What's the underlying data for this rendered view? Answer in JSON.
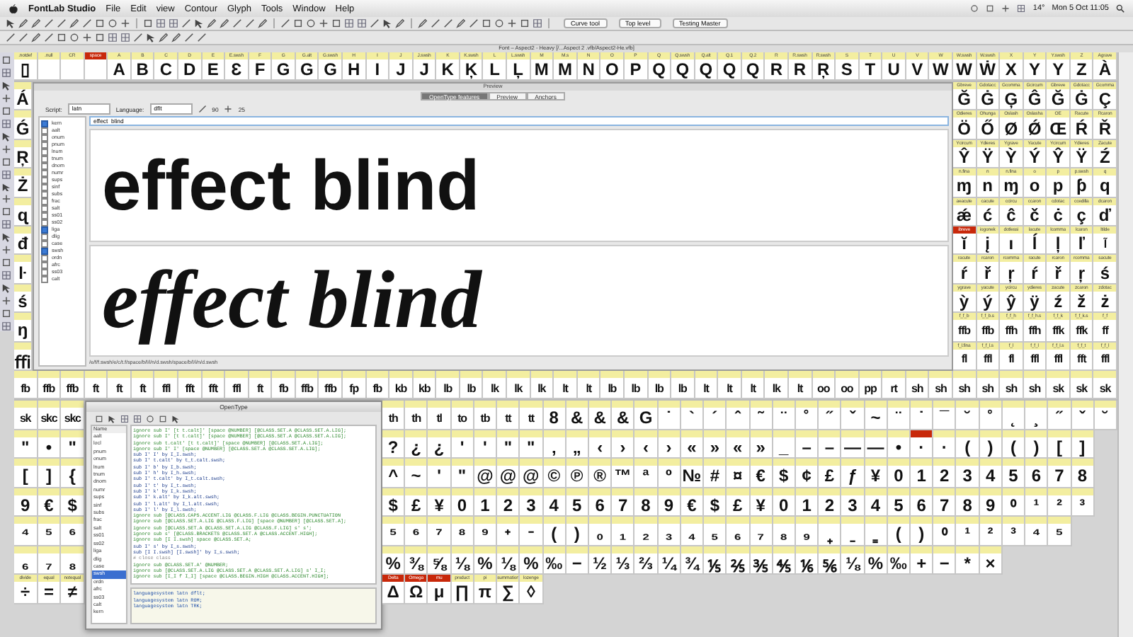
{
  "menubar": {
    "app": "FontLab Studio",
    "items": [
      "File",
      "Edit",
      "view",
      "Contour",
      "Glyph",
      "Tools",
      "Window",
      "Help"
    ],
    "temperature": "14°",
    "clock": "Mon 5 Oct  11:05"
  },
  "toolbar": {
    "dropdowns": [
      "Curve tool",
      "Top level",
      "Testing Master"
    ]
  },
  "font_window": {
    "title": "Font – Aspect2 - Heavy [/...Aspect 2 .vfb/Aspect2-He.vfb]",
    "top_row": [
      {
        "label": ".notdef",
        "glyph": "▯",
        "marked": false
      },
      {
        "label": ".null",
        "marked": false
      },
      {
        "label": "CR",
        "marked": false
      },
      {
        "label": "space",
        "marked": true
      },
      {
        "label": "A",
        "glyph": "A",
        "marked": false
      },
      {
        "label": "B",
        "glyph": "B",
        "marked": false
      },
      {
        "label": "C",
        "glyph": "C",
        "marked": false
      },
      {
        "label": "D",
        "glyph": "D",
        "marked": false
      },
      {
        "label": "E",
        "glyph": "E",
        "marked": false
      },
      {
        "label": "E.swsh",
        "glyph": "Ɛ",
        "marked": false
      },
      {
        "label": "F",
        "glyph": "F",
        "marked": false
      },
      {
        "label": "G",
        "glyph": "G",
        "marked": false
      },
      {
        "label": "G.alt",
        "glyph": "G",
        "marked": false
      },
      {
        "label": "G.swsh",
        "glyph": "G",
        "marked": false
      },
      {
        "label": "H",
        "glyph": "H",
        "marked": false
      },
      {
        "label": "I",
        "glyph": "I",
        "marked": false
      },
      {
        "label": "J",
        "glyph": "J",
        "marked": false
      },
      {
        "label": "J.swsh",
        "glyph": "J",
        "marked": false
      },
      {
        "label": "K",
        "glyph": "K",
        "marked": false
      },
      {
        "label": "K.swsh",
        "glyph": "Ķ",
        "marked": false
      },
      {
        "label": "L",
        "glyph": "L",
        "marked": false
      },
      {
        "label": "L.swsh",
        "glyph": "Ļ",
        "marked": false
      },
      {
        "label": "M",
        "glyph": "M",
        "marked": false
      },
      {
        "label": "M.s",
        "glyph": "M",
        "marked": false
      },
      {
        "label": "N",
        "glyph": "N",
        "marked": false
      },
      {
        "label": "O",
        "glyph": "O",
        "marked": false
      },
      {
        "label": "P",
        "glyph": "P",
        "marked": false
      },
      {
        "label": "Q",
        "glyph": "Q",
        "marked": false
      },
      {
        "label": "Q.swsh",
        "glyph": "Q",
        "marked": false
      },
      {
        "label": "Q.alt",
        "glyph": "Q",
        "marked": false
      },
      {
        "label": "Q.1",
        "glyph": "Q",
        "marked": false
      },
      {
        "label": "Q.2",
        "glyph": "Q",
        "marked": false
      },
      {
        "label": "R",
        "glyph": "R",
        "marked": false
      },
      {
        "label": "R.swsh",
        "glyph": "R",
        "marked": false
      },
      {
        "label": "R.swsh",
        "glyph": "Ŗ",
        "marked": false
      },
      {
        "label": "S",
        "glyph": "S",
        "marked": false
      },
      {
        "label": "T",
        "glyph": "T",
        "marked": false
      },
      {
        "label": "U",
        "glyph": "U",
        "marked": false
      },
      {
        "label": "V",
        "glyph": "V",
        "marked": false
      },
      {
        "label": "W",
        "glyph": "W",
        "marked": false
      },
      {
        "label": "W.swsh",
        "glyph": "W",
        "marked": false
      },
      {
        "label": "W.swsh",
        "glyph": "Ẇ",
        "marked": false
      },
      {
        "label": "X",
        "glyph": "X",
        "marked": false
      },
      {
        "label": "Y",
        "glyph": "Y",
        "marked": false
      },
      {
        "label": "Y.swsh",
        "glyph": "Y",
        "marked": false
      },
      {
        "label": "Z",
        "glyph": "Z",
        "marked": false
      },
      {
        "label": "Agrave",
        "glyph": "À",
        "marked": false
      }
    ],
    "left_column": [
      {
        "glyph": "Á",
        "marked": false
      },
      {
        "glyph": "Ǵ",
        "marked": false
      },
      {
        "glyph": "Ŗ",
        "marked": false
      },
      {
        "glyph": "Ż",
        "marked": false
      },
      {
        "glyph": "ɋ",
        "marked": false
      },
      {
        "glyph": "đ",
        "marked": false
      },
      {
        "glyph": "ŀ",
        "marked": false
      },
      {
        "glyph": "ś",
        "marked": false
      },
      {
        "glyph": "ŋ",
        "marked": false
      },
      {
        "glyph": "ﬃ",
        "marked": false
      }
    ],
    "right_columns": [
      {
        "cells": [
          {
            "label": "Gbreve",
            "glyph": "Ğ",
            "marked": false
          },
          {
            "label": "Gdotacc",
            "glyph": "Ġ",
            "marked": false
          },
          {
            "label": "Gcomma",
            "glyph": "Ģ",
            "marked": false
          },
          {
            "label": "Gcircum",
            "glyph": "Ĝ",
            "marked": false
          },
          {
            "label": "Gbreve",
            "glyph": "Ğ",
            "marked": false
          },
          {
            "label": "Gdotacc",
            "glyph": "Ġ",
            "marked": false
          },
          {
            "label": "Gcomma",
            "glyph": "Ç",
            "marked": false
          }
        ]
      },
      {
        "cells": [
          {
            "label": "Odieres",
            "glyph": "Ö",
            "marked": false
          },
          {
            "label": "Ohunga",
            "glyph": "Ő",
            "marked": false
          },
          {
            "label": "Oslash",
            "glyph": "Ø",
            "marked": false
          },
          {
            "label": "Oslasha",
            "glyph": "Ǿ",
            "marked": false
          },
          {
            "label": "OE",
            "glyph": "Œ",
            "marked": false
          },
          {
            "label": "Racute",
            "glyph": "Ŕ",
            "marked": false
          },
          {
            "label": "Rcaron",
            "glyph": "Ř",
            "marked": false
          }
        ]
      },
      {
        "cells": [
          {
            "label": "Ycircum",
            "glyph": "Ŷ",
            "marked": false
          },
          {
            "label": "Ydieres",
            "glyph": "Ÿ",
            "marked": false
          },
          {
            "label": "Ygrave",
            "glyph": "Ỳ",
            "marked": false
          },
          {
            "label": "Yacute",
            "glyph": "Ý",
            "marked": false
          },
          {
            "label": "Ycircum",
            "glyph": "Ŷ",
            "marked": false
          },
          {
            "label": "Ydieres",
            "glyph": "Ÿ",
            "marked": false
          },
          {
            "label": "Zacute",
            "glyph": "Ź",
            "marked": false
          }
        ]
      },
      {
        "cells": [
          {
            "label": "n.fina",
            "glyph": "ɱ",
            "marked": false
          },
          {
            "label": "n",
            "glyph": "n",
            "marked": false
          },
          {
            "label": "n.fina",
            "glyph": "ɱ",
            "marked": false
          },
          {
            "label": "o",
            "glyph": "o",
            "marked": false
          },
          {
            "label": "p",
            "glyph": "p",
            "marked": false
          },
          {
            "label": "p.swsh",
            "glyph": "ƥ",
            "marked": false
          },
          {
            "label": "q",
            "glyph": "q",
            "marked": false
          }
        ]
      },
      {
        "cells": [
          {
            "label": "aeacute",
            "glyph": "ǽ",
            "marked": false
          },
          {
            "label": "cacute",
            "glyph": "ć",
            "marked": false
          },
          {
            "label": "ccircu",
            "glyph": "ĉ",
            "marked": false
          },
          {
            "label": "ccaron",
            "glyph": "č",
            "marked": false
          },
          {
            "label": "cdotac",
            "glyph": "ċ",
            "marked": false
          },
          {
            "label": "ccedilla",
            "glyph": "ç",
            "marked": false
          },
          {
            "label": "dcaron",
            "glyph": "ď",
            "marked": false
          }
        ]
      },
      {
        "cells": [
          {
            "label": "ibreve",
            "glyph": "ĭ",
            "marked": true
          },
          {
            "label": "iogonek",
            "glyph": "į",
            "marked": false
          },
          {
            "label": "dotlessi",
            "glyph": "ı",
            "marked": false
          },
          {
            "label": "lacute",
            "glyph": "ĺ",
            "marked": false
          },
          {
            "label": "lcomma",
            "glyph": "ļ",
            "marked": false
          },
          {
            "label": "lcaron",
            "glyph": "ľ",
            "marked": false
          },
          {
            "label": "ltilde",
            "glyph": "l̃",
            "marked": false
          }
        ]
      },
      {
        "cells": [
          {
            "label": "racute",
            "glyph": "ŕ",
            "marked": false
          },
          {
            "label": "rcaron",
            "glyph": "ř",
            "marked": false
          },
          {
            "label": "rcomma",
            "glyph": "ŗ",
            "marked": false
          },
          {
            "label": "racute",
            "glyph": "ŕ",
            "marked": false
          },
          {
            "label": "rcaron",
            "glyph": "ř",
            "marked": false
          },
          {
            "label": "rcomma",
            "glyph": "ŗ",
            "marked": false
          },
          {
            "label": "sacute",
            "glyph": "ś",
            "marked": false
          }
        ]
      },
      {
        "cells": [
          {
            "label": "ygrave",
            "glyph": "ỳ",
            "marked": false
          },
          {
            "label": "yacute",
            "glyph": "ý",
            "marked": false
          },
          {
            "label": "ycircu",
            "glyph": "ŷ",
            "marked": false
          },
          {
            "label": "ydieres",
            "glyph": "ÿ",
            "marked": false
          },
          {
            "label": "zacute",
            "glyph": "ź",
            "marked": false
          },
          {
            "label": "zcaron",
            "glyph": "ž",
            "marked": false
          },
          {
            "label": "zdotac",
            "glyph": "ż",
            "marked": false
          }
        ]
      },
      {
        "cells": [
          {
            "label": "f_f_b",
            "glyph": "ffb",
            "marked": false
          },
          {
            "label": "f_f_b.s",
            "glyph": "ffb",
            "marked": false
          },
          {
            "label": "f_f_h",
            "glyph": "ffh",
            "marked": false
          },
          {
            "label": "f_f_h.s",
            "glyph": "ffh",
            "marked": false
          },
          {
            "label": "f_f_k",
            "glyph": "ffk",
            "marked": false
          },
          {
            "label": "f_f_k.s",
            "glyph": "ffk",
            "marked": false
          },
          {
            "label": "f_f",
            "glyph": "ff",
            "marked": false
          }
        ]
      },
      {
        "cells": [
          {
            "label": "f_l.fina",
            "glyph": "fl",
            "marked": false
          },
          {
            "label": "f_f_l.s",
            "glyph": "ffl",
            "marked": false
          },
          {
            "label": "f_l",
            "glyph": "fl",
            "marked": false
          },
          {
            "label": "f_f_l",
            "glyph": "ffl",
            "marked": false
          },
          {
            "label": "f_f_l.s",
            "glyph": "ffl",
            "marked": false
          },
          {
            "label": "f_f_t",
            "glyph": "fft",
            "marked": false
          },
          {
            "label": "f_f_l",
            "glyph": "ffl",
            "marked": false
          }
        ]
      }
    ],
    "ligature_row": [
      "fb",
      "ffb",
      "ffb",
      "ft",
      "ft",
      "ft",
      "ffl",
      "fft",
      "fft",
      "ffl",
      "ft",
      "fb",
      "ffb",
      "ffb",
      "fp",
      "fb",
      "kb",
      "kb",
      "lb",
      "lb",
      "lk",
      "lk",
      "lk",
      "lt",
      "lt",
      "lb",
      "lb",
      "lb",
      "lb",
      "lt",
      "lt",
      "lt",
      "lk",
      "lt",
      "oo",
      "oo",
      "pp",
      "rt",
      "sh",
      "sh",
      "sh",
      "sh",
      "sh",
      "sh",
      "sk",
      "sk",
      "sk"
    ],
    "lower_left": [
      {
        "cells": [
          {
            "glyph": "sk",
            "marked": false
          },
          {
            "glyph": "skc",
            "marked": false
          },
          {
            "glyph": "skc",
            "marked": false
          }
        ]
      },
      {
        "cells": [
          {
            "glyph": "\"",
            "marked": false
          },
          {
            "glyph": "•",
            "marked": false
          },
          {
            "glyph": "\"",
            "marked": false
          }
        ]
      },
      {
        "cells": [
          {
            "glyph": "[",
            "marked": false
          },
          {
            "glyph": "]",
            "marked": false
          },
          {
            "glyph": "{",
            "marked": false
          }
        ]
      },
      {
        "cells": [
          {
            "glyph": "9",
            "marked": false
          },
          {
            "glyph": "€",
            "marked": false
          },
          {
            "glyph": "$",
            "marked": false
          }
        ]
      },
      {
        "cells": [
          {
            "glyph": "⁴",
            "marked": false
          },
          {
            "glyph": "⁵",
            "marked": false
          },
          {
            "glyph": "⁶",
            "marked": false
          }
        ]
      },
      {
        "cells": [
          {
            "glyph": "₆",
            "marked": false
          },
          {
            "glyph": "₇",
            "marked": false
          },
          {
            "glyph": "₈",
            "marked": false
          }
        ]
      },
      {
        "cells": [
          {
            "label": "divide",
            "glyph": "÷",
            "marked": false
          },
          {
            "label": "equal",
            "glyph": "=",
            "marked": false
          },
          {
            "label": "notequal",
            "glyph": "≠",
            "marked": false
          }
        ]
      }
    ],
    "lower_right": [
      {
        "cells": [
          {
            "glyph": "th",
            "marked": false
          },
          {
            "glyph": "th",
            "marked": false
          },
          {
            "glyph": "tl",
            "marked": false
          },
          {
            "glyph": "to",
            "marked": false
          },
          {
            "glyph": "tb",
            "marked": false
          },
          {
            "glyph": "tt",
            "marked": false
          },
          {
            "glyph": "tt",
            "marked": false
          },
          {
            "glyph": "8",
            "marked": false
          },
          {
            "glyph": "&",
            "marked": false
          },
          {
            "glyph": "&",
            "marked": false
          },
          {
            "glyph": "&",
            "marked": false
          },
          {
            "glyph": "G",
            "marked": false
          },
          {
            "glyph": "˙",
            "marked": false
          },
          {
            "glyph": "`",
            "marked": false
          },
          {
            "glyph": "´",
            "marked": false
          },
          {
            "glyph": "ˆ",
            "marked": false
          },
          {
            "glyph": "˜",
            "marked": false
          },
          {
            "glyph": "¨",
            "marked": false
          },
          {
            "glyph": "˚",
            "marked": false
          },
          {
            "glyph": "˝",
            "marked": false
          },
          {
            "glyph": "ˇ",
            "marked": false
          },
          {
            "glyph": "~",
            "marked": false
          },
          {
            "glyph": "¨",
            "marked": false
          },
          {
            "glyph": "˙",
            "marked": false
          },
          {
            "glyph": "¯",
            "marked": false
          },
          {
            "glyph": "˘",
            "marked": false
          },
          {
            "glyph": "˚",
            "marked": false
          },
          {
            "glyph": "˛",
            "marked": false
          },
          {
            "glyph": "¸",
            "marked": false
          },
          {
            "glyph": "˝",
            "marked": false
          },
          {
            "glyph": "ˇ",
            "marked": false
          },
          {
            "glyph": "˘",
            "marked": false
          }
        ]
      },
      {
        "cells": [
          {
            "glyph": "?",
            "marked": false
          },
          {
            "glyph": "¿",
            "marked": false
          },
          {
            "glyph": "¿",
            "marked": false
          },
          {
            "glyph": "'",
            "marked": false
          },
          {
            "glyph": "'",
            "marked": false
          },
          {
            "glyph": "\"",
            "marked": false
          },
          {
            "glyph": "\"",
            "marked": false
          },
          {
            "glyph": "‚",
            "marked": false
          },
          {
            "glyph": "„",
            "marked": false
          },
          {
            "glyph": "‹",
            "marked": false
          },
          {
            "glyph": "›",
            "marked": false
          },
          {
            "glyph": "‹",
            "marked": false
          },
          {
            "glyph": "›",
            "marked": false
          },
          {
            "glyph": "«",
            "marked": false
          },
          {
            "glyph": "»",
            "marked": false
          },
          {
            "glyph": "«",
            "marked": false
          },
          {
            "glyph": "»",
            "marked": false
          },
          {
            "glyph": "_",
            "marked": false
          },
          {
            "glyph": "–",
            "marked": false
          },
          {
            "glyph": "–",
            "marked": false
          },
          {
            "glyph": "—",
            "marked": false
          },
          {
            "glyph": "—",
            "marked": false
          },
          {
            "glyph": "•",
            "marked": false
          },
          {
            "glyph": "·",
            "marked": true
          },
          {
            "glyph": "·",
            "marked": false
          },
          {
            "glyph": "(",
            "marked": false
          },
          {
            "glyph": ")",
            "marked": false
          },
          {
            "glyph": "(",
            "marked": false
          },
          {
            "glyph": ")",
            "marked": false
          },
          {
            "glyph": "[",
            "marked": false
          },
          {
            "glyph": "]",
            "marked": false
          }
        ]
      },
      {
        "cells": [
          {
            "glyph": "^",
            "marked": false
          },
          {
            "glyph": "~",
            "marked": false
          },
          {
            "glyph": "'",
            "marked": false
          },
          {
            "glyph": "\"",
            "marked": false
          },
          {
            "glyph": "@",
            "marked": false
          },
          {
            "glyph": "@",
            "marked": false
          },
          {
            "glyph": "@",
            "marked": false
          },
          {
            "glyph": "©",
            "marked": false
          },
          {
            "glyph": "℗",
            "marked": false
          },
          {
            "glyph": "®",
            "marked": false
          },
          {
            "glyph": "™",
            "marked": false
          },
          {
            "glyph": "ª",
            "marked": false
          },
          {
            "glyph": "º",
            "marked": false
          },
          {
            "glyph": "№",
            "marked": false
          },
          {
            "glyph": "#",
            "marked": false
          },
          {
            "glyph": "¤",
            "marked": false
          },
          {
            "glyph": "€",
            "marked": false
          },
          {
            "glyph": "$",
            "marked": false
          },
          {
            "glyph": "¢",
            "marked": false
          },
          {
            "glyph": "£",
            "marked": false
          },
          {
            "glyph": "ƒ",
            "marked": false
          },
          {
            "glyph": "¥",
            "marked": false
          },
          {
            "glyph": "0",
            "marked": false
          },
          {
            "glyph": "1",
            "marked": false
          },
          {
            "glyph": "2",
            "marked": false
          },
          {
            "glyph": "3",
            "marked": false
          },
          {
            "glyph": "4",
            "marked": false
          },
          {
            "glyph": "5",
            "marked": false
          },
          {
            "glyph": "6",
            "marked": false
          },
          {
            "glyph": "7",
            "marked": false
          },
          {
            "glyph": "8",
            "marked": false
          }
        ]
      },
      {
        "cells": [
          {
            "glyph": "$",
            "marked": false
          },
          {
            "glyph": "£",
            "marked": false
          },
          {
            "glyph": "¥",
            "marked": false
          },
          {
            "glyph": "0",
            "marked": false
          },
          {
            "glyph": "1",
            "marked": false
          },
          {
            "glyph": "2",
            "marked": false
          },
          {
            "glyph": "3",
            "marked": false
          },
          {
            "glyph": "4",
            "marked": false
          },
          {
            "glyph": "5",
            "marked": false
          },
          {
            "glyph": "6",
            "marked": false
          },
          {
            "glyph": "7",
            "marked": false
          },
          {
            "glyph": "8",
            "marked": false
          },
          {
            "glyph": "9",
            "marked": false
          },
          {
            "glyph": "€",
            "marked": false
          },
          {
            "glyph": "$",
            "marked": false
          },
          {
            "glyph": "£",
            "marked": false
          },
          {
            "glyph": "¥",
            "marked": false
          },
          {
            "glyph": "0",
            "marked": false
          },
          {
            "glyph": "1",
            "marked": false
          },
          {
            "glyph": "2",
            "marked": false
          },
          {
            "glyph": "3",
            "marked": false
          },
          {
            "glyph": "4",
            "marked": false
          },
          {
            "glyph": "5",
            "marked": false
          },
          {
            "glyph": "6",
            "marked": false
          },
          {
            "glyph": "7",
            "marked": false
          },
          {
            "glyph": "8",
            "marked": false
          },
          {
            "glyph": "9",
            "marked": false
          },
          {
            "glyph": "⁰",
            "marked": false
          },
          {
            "glyph": "¹",
            "marked": false
          },
          {
            "glyph": "²",
            "marked": false
          },
          {
            "glyph": "³",
            "marked": false
          }
        ]
      },
      {
        "cells": [
          {
            "glyph": "⁵",
            "marked": false
          },
          {
            "glyph": "⁶",
            "marked": false
          },
          {
            "glyph": "⁷",
            "marked": false
          },
          {
            "glyph": "⁸",
            "marked": false
          },
          {
            "glyph": "⁹",
            "marked": false
          },
          {
            "glyph": "⁺",
            "marked": false
          },
          {
            "glyph": "⁻",
            "marked": false
          },
          {
            "glyph": "(",
            "marked": false
          },
          {
            "glyph": ")",
            "marked": false
          },
          {
            "glyph": "₀",
            "marked": false
          },
          {
            "glyph": "₁",
            "marked": false
          },
          {
            "glyph": "₂",
            "marked": false
          },
          {
            "glyph": "₃",
            "marked": false
          },
          {
            "glyph": "₄",
            "marked": false
          },
          {
            "glyph": "₅",
            "marked": false
          },
          {
            "glyph": "₆",
            "marked": false
          },
          {
            "glyph": "₇",
            "marked": false
          },
          {
            "glyph": "₈",
            "marked": false
          },
          {
            "glyph": "₉",
            "marked": false
          },
          {
            "glyph": "₊",
            "marked": false
          },
          {
            "glyph": "₋",
            "marked": false
          },
          {
            "glyph": "₌",
            "marked": false
          },
          {
            "glyph": "(",
            "marked": false
          },
          {
            "glyph": ")",
            "marked": false
          },
          {
            "glyph": "⁰",
            "marked": false
          },
          {
            "glyph": "¹",
            "marked": false
          },
          {
            "glyph": "²",
            "marked": false
          },
          {
            "glyph": "³",
            "marked": false
          },
          {
            "glyph": "⁴",
            "marked": false
          },
          {
            "glyph": "⁵",
            "marked": false
          }
        ]
      },
      {
        "cells": [
          {
            "glyph": "%",
            "marked": false
          },
          {
            "glyph": "⅜",
            "marked": false
          },
          {
            "glyph": "⅝",
            "marked": false
          },
          {
            "glyph": "⅛",
            "marked": false
          },
          {
            "glyph": "%",
            "marked": false
          },
          {
            "glyph": "⅛",
            "marked": false
          },
          {
            "glyph": "%",
            "marked": false
          },
          {
            "glyph": "‰",
            "marked": false
          },
          {
            "glyph": "−",
            "marked": false
          },
          {
            "glyph": "½",
            "marked": false
          },
          {
            "glyph": "⅓",
            "marked": false
          },
          {
            "glyph": "⅔",
            "marked": false
          },
          {
            "glyph": "¼",
            "marked": false
          },
          {
            "glyph": "¾",
            "marked": false
          },
          {
            "glyph": "⅕",
            "marked": false
          },
          {
            "glyph": "⅖",
            "marked": false
          },
          {
            "glyph": "⅗",
            "marked": false
          },
          {
            "glyph": "⅘",
            "marked": false
          },
          {
            "glyph": "⅙",
            "marked": false
          },
          {
            "glyph": "⅚",
            "marked": false
          },
          {
            "glyph": "⅛",
            "marked": false
          },
          {
            "glyph": "%",
            "marked": false
          },
          {
            "glyph": "‰",
            "marked": false
          },
          {
            "glyph": "+",
            "marked": false
          },
          {
            "glyph": "−",
            "marked": false
          },
          {
            "glyph": "*",
            "marked": false
          },
          {
            "glyph": "×",
            "marked": false
          }
        ]
      },
      {
        "cells": [
          {
            "label": "Delta",
            "glyph": "Δ",
            "marked": true
          },
          {
            "label": "Omega",
            "glyph": "Ω",
            "marked": true
          },
          {
            "label": "mu",
            "glyph": "μ",
            "marked": true
          },
          {
            "label": "product",
            "glyph": "∏",
            "marked": false
          },
          {
            "label": "pi",
            "glyph": "π",
            "marked": false
          },
          {
            "label": "summation",
            "glyph": "∑",
            "marked": false
          },
          {
            "label": "lozenge",
            "glyph": "◊",
            "marked": false
          }
        ]
      }
    ]
  },
  "preview": {
    "title": "Preview",
    "tabs": [
      {
        "label": "OpenType features",
        "selected": true
      },
      {
        "label": "Preview",
        "selected": false
      },
      {
        "label": "Anchors",
        "selected": false
      }
    ],
    "script_label": "Script:",
    "script": "latn",
    "language_label": "Language:",
    "language": "dflt",
    "line_size": "90",
    "spacing": "25",
    "features": [
      {
        "label": "kern",
        "checked": true
      },
      {
        "label": "aalt",
        "checked": false
      },
      {
        "label": "onum",
        "checked": false
      },
      {
        "label": "pnum",
        "checked": false
      },
      {
        "label": "lnum",
        "checked": false
      },
      {
        "label": "tnum",
        "checked": false
      },
      {
        "label": "dnom",
        "checked": false
      },
      {
        "label": "numr",
        "checked": false
      },
      {
        "label": "sups",
        "checked": false
      },
      {
        "label": "sinf",
        "checked": false
      },
      {
        "label": "subs",
        "checked": false
      },
      {
        "label": "frac",
        "checked": false
      },
      {
        "label": "salt",
        "checked": false
      },
      {
        "label": "ss01",
        "checked": false
      },
      {
        "label": "ss02",
        "checked": false
      },
      {
        "label": "liga",
        "checked": true
      },
      {
        "label": "dlig",
        "checked": false
      },
      {
        "label": "case",
        "checked": false
      },
      {
        "label": "swsh",
        "checked": true
      },
      {
        "label": "ordn",
        "checked": false
      },
      {
        "label": "afrc",
        "checked": false
      },
      {
        "label": "ss03",
        "checked": false
      },
      {
        "label": "calt",
        "checked": false
      }
    ],
    "text": "effect  blind",
    "samples": [
      {
        "kind": "plain",
        "text": "effect blind"
      },
      {
        "kind": "swash",
        "text": "effect blind"
      }
    ],
    "glyph_string": "/e/f/f.swsh/e/c/t.f/space/b/l/i/n/d.swsh/space/b/l/i/n/d.swsh"
  },
  "opentype": {
    "title": "OpenType",
    "list_header": "Name",
    "features": [
      {
        "label": "aalt",
        "selected": false
      },
      {
        "label": "locl",
        "selected": false
      },
      {
        "label": "pnum",
        "selected": false
      },
      {
        "label": "onum",
        "selected": false
      },
      {
        "label": "lnum",
        "selected": false
      },
      {
        "label": "tnum",
        "selected": false
      },
      {
        "label": "dnom",
        "selected": false
      },
      {
        "label": "numr",
        "selected": false
      },
      {
        "label": "sups",
        "selected": false
      },
      {
        "label": "sinf",
        "selected": false
      },
      {
        "label": "subs",
        "selected": false
      },
      {
        "label": "frac",
        "selected": false
      },
      {
        "label": "salt",
        "selected": false
      },
      {
        "label": "ss01",
        "selected": false
      },
      {
        "label": "ss02",
        "selected": false
      },
      {
        "label": "liga",
        "selected": false
      },
      {
        "label": "dlig",
        "selected": false
      },
      {
        "label": "case",
        "selected": false
      },
      {
        "label": "swsh",
        "selected": true
      },
      {
        "label": "ordn",
        "selected": false
      },
      {
        "label": "afrc",
        "selected": false
      },
      {
        "label": "ss03",
        "selected": false
      },
      {
        "label": "calt",
        "selected": false
      },
      {
        "label": "kern",
        "selected": false
      }
    ],
    "code": [
      {
        "kind": "ignore",
        "text": "ignore sub I' [t t.calt]' [space @NUMBER] [@CLASS.SET.A @CLASS.SET.A.LIG];"
      },
      {
        "kind": "ignore",
        "text": "ignore sub I' [t t.calt]' [space @NUMBER] [@CLASS.SET.A @CLASS.SET.A.LIG];"
      },
      {
        "kind": "ignore",
        "text": "ignore sub t.calt' [t t.calt]' [space @NUMBER] [@CLASS.SET.A.LIG];"
      },
      {
        "kind": "ignore",
        "text": "ignore sub I' I' [space @NUMBER] [@CLASS.SET.A @CLASS.SET.A.LIG];"
      },
      {
        "kind": "sub",
        "text": "sub I' I' by I_I.swsh;"
      },
      {
        "kind": "sub",
        "text": "sub I' t.calt' by t_t.calt.swsh;"
      },
      {
        "kind": "sub",
        "text": "sub I' b' by I_b.swsh;"
      },
      {
        "kind": "sub",
        "text": "sub I' h' by I_h.swsh;"
      },
      {
        "kind": "sub",
        "text": "sub I' t.calt' by I_t.calt.swsh;"
      },
      {
        "kind": "sub",
        "text": "sub I' t' by I_t.swsh;"
      },
      {
        "kind": "sub",
        "text": "sub I' k' by I_k.swsh;"
      },
      {
        "kind": "sub",
        "text": "sub I' k.alt' by I_k.alt.swsh;"
      },
      {
        "kind": "sub",
        "text": "sub I' l.alt' by I_l.alt.swsh;"
      },
      {
        "kind": "sub",
        "text": "sub I' l' by I_l.swsh;"
      },
      {
        "kind": "ignore",
        "text": "ignore sub [@CLASS.CAPS.ACCENT.LIG @CLASS.F.LIG @CLASS.BEGIN.PUNCTUATION"
      },
      {
        "kind": "ignore",
        "text": "ignore sub [@CLASS.SET.A.LIG @CLASS.F.LIG] [space @NUMBER] [@CLASS.SET.A];"
      },
      {
        "kind": "ignore",
        "text": "ignore sub [@CLASS.SET.A @CLASS.SET.A.LIG @CLASS.F.LIG] s' s';"
      },
      {
        "kind": "ignore",
        "text": "ignore sub s' [@CLASS.BRACKETS @CLASS.SET.A @CLASS.ACCENT.HIGH];"
      },
      {
        "kind": "ignore",
        "text": "ignore sub [I I.swsh] space @CLASS.SET.A;"
      },
      {
        "kind": "sub",
        "text": "sub I' s' by I_s.swsh;"
      },
      {
        "kind": "sub",
        "text": "sub [I I.swsh] [I.swsh]' by I_s.swsh;"
      },
      {
        "kind": "comment",
        "text": "# close class"
      },
      {
        "kind": "ignore",
        "text": "ignore sub @CLASS.SET.A' @NUMBER;"
      },
      {
        "kind": "ignore",
        "text": "ignore sub [@CLASS.SET.A.LIG @CLASS.SET.A @CLASS.SET.A.LIG] s' I_I;"
      },
      {
        "kind": "ignore",
        "text": "ignore sub [I_I f I_I] [space @CLASS.BEGIN.HIGH @CLASS.ACCENT.HIGH];"
      }
    ],
    "languagesystems": [
      "languagesystem latn dflt;",
      "languagesystem latn ROM;",
      "languagesystem latn TRK;"
    ]
  }
}
